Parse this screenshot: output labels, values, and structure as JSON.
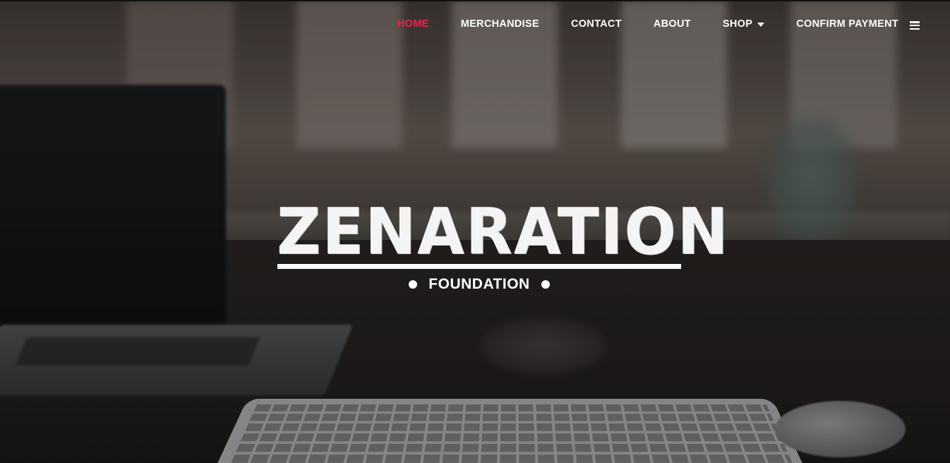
{
  "nav": {
    "items": [
      {
        "label": "HOME",
        "active": true
      },
      {
        "label": "MERCHANDISE"
      },
      {
        "label": "CONTACT"
      },
      {
        "label": "ABOUT"
      },
      {
        "label": "SHOP",
        "has_dropdown": true
      },
      {
        "label": "CONFIRM PAYMENT"
      }
    ],
    "menu_icon": "hamburger-icon"
  },
  "hero": {
    "logo_title": "ZENARATION",
    "logo_subtitle": "FOUNDATION"
  },
  "colors": {
    "accent": "#e8254f",
    "nav_text": "#ffffff"
  }
}
